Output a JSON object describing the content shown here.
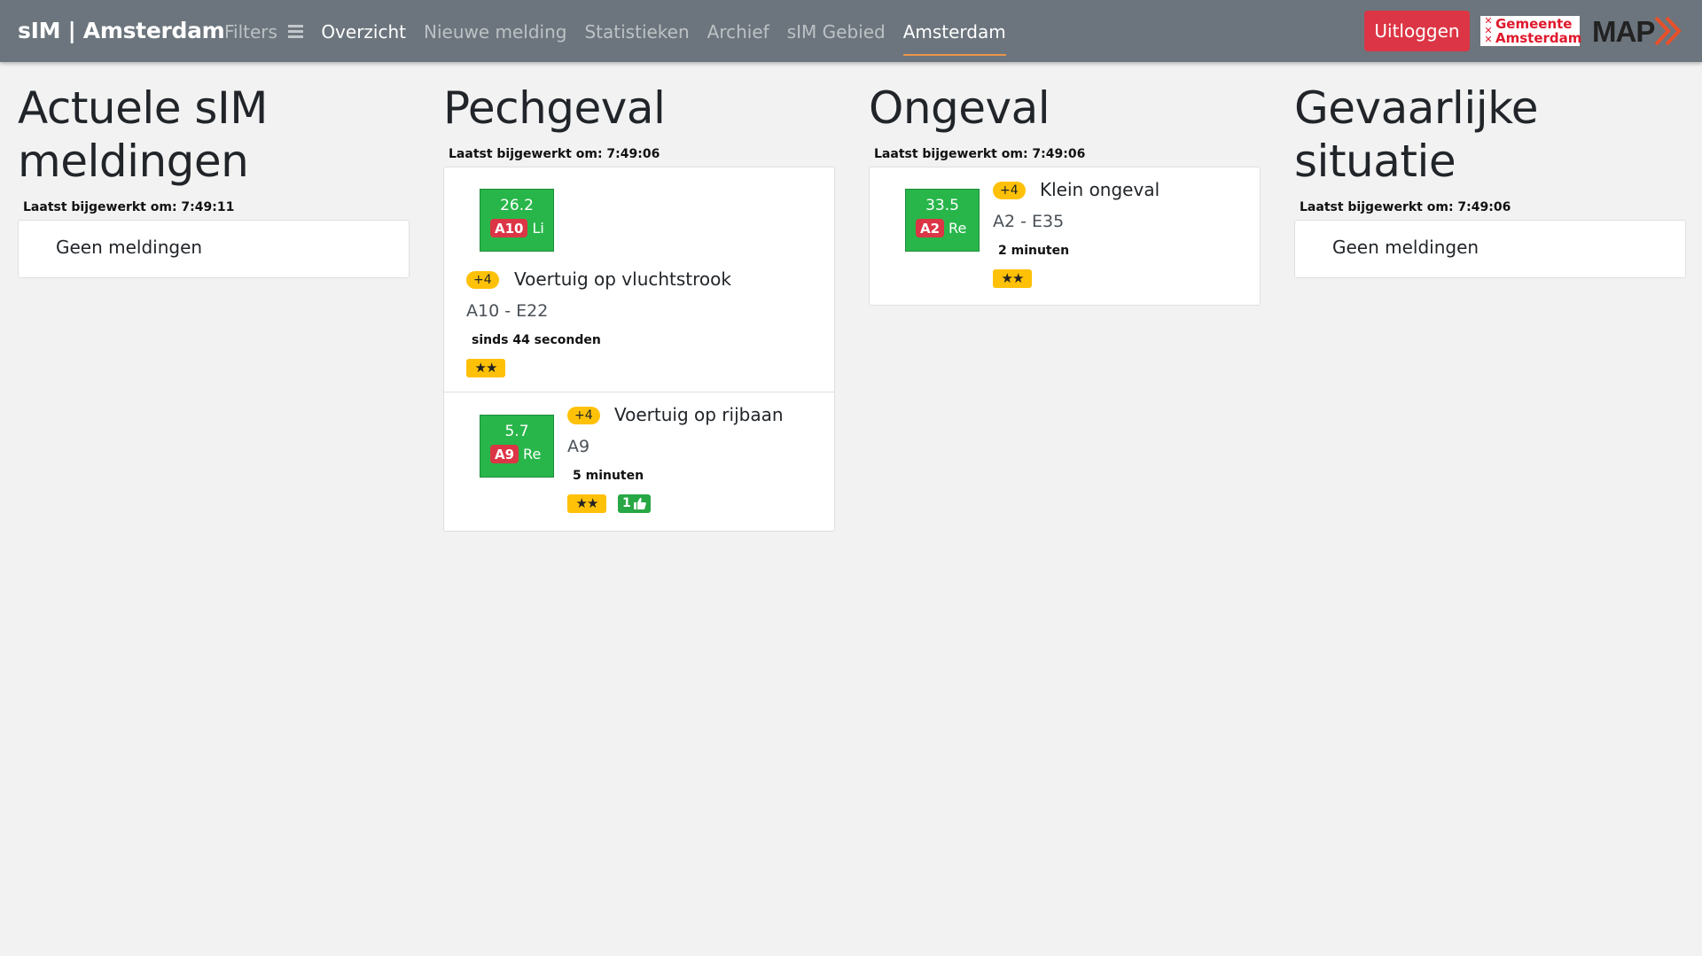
{
  "navbar": {
    "brand": "sIM | Amsterdam",
    "filters_label": "Filters",
    "items": [
      {
        "label": "Overzicht"
      },
      {
        "label": "Nieuwe melding"
      },
      {
        "label": "Statistieken"
      },
      {
        "label": "Archief"
      },
      {
        "label": "sIM Gebied"
      },
      {
        "label": "Amsterdam"
      }
    ],
    "logout_label": "Uitloggen",
    "gemeente_logo_line1": "Gemeente",
    "gemeente_logo_line2": "Amsterdam",
    "map_logo_text": "MAP"
  },
  "columns": {
    "actueel": {
      "title_line1": "Actuele sIM",
      "title_line2": "meldingen",
      "updated": "Laatst bijgewerkt om: 7:49:11",
      "empty": "Geen meldingen"
    },
    "pechgeval": {
      "title": "Pechgeval",
      "updated": "Laatst bijgewerkt om: 7:49:06",
      "items": [
        {
          "speed": "26.2",
          "road": "A10",
          "lane": "Li",
          "priority": "+4",
          "title": "Voertuig op vluchtstrook",
          "location": "A10 - E22",
          "time": "sinds 44 seconden",
          "stars": "★★"
        },
        {
          "speed": "5.7",
          "road": "A9",
          "lane": "Re",
          "priority": "+4",
          "title": "Voertuig op rijbaan",
          "location": "A9",
          "time": "5 minuten",
          "stars": "★★",
          "likes": "1"
        }
      ]
    },
    "ongeval": {
      "title": "Ongeval",
      "updated": "Laatst bijgewerkt om: 7:49:06",
      "items": [
        {
          "speed": "33.5",
          "road": "A2",
          "lane": "Re",
          "priority": "+4",
          "title": "Klein ongeval",
          "location": "A2 - E35",
          "time": "2 minuten",
          "stars": "★★"
        }
      ]
    },
    "gevaarlijk": {
      "title": "Gevaarlijke situatie",
      "updated": "Laatst bijgewerkt om: 7:49:06",
      "empty": "Geen meldingen"
    }
  },
  "colors": {
    "navbar": "#6c757d",
    "logout": "#dc3545",
    "speed_box": "#28b64a",
    "priority": "#ffc107",
    "road_badge": "#dc3545",
    "active_underline": "#e8964a"
  }
}
